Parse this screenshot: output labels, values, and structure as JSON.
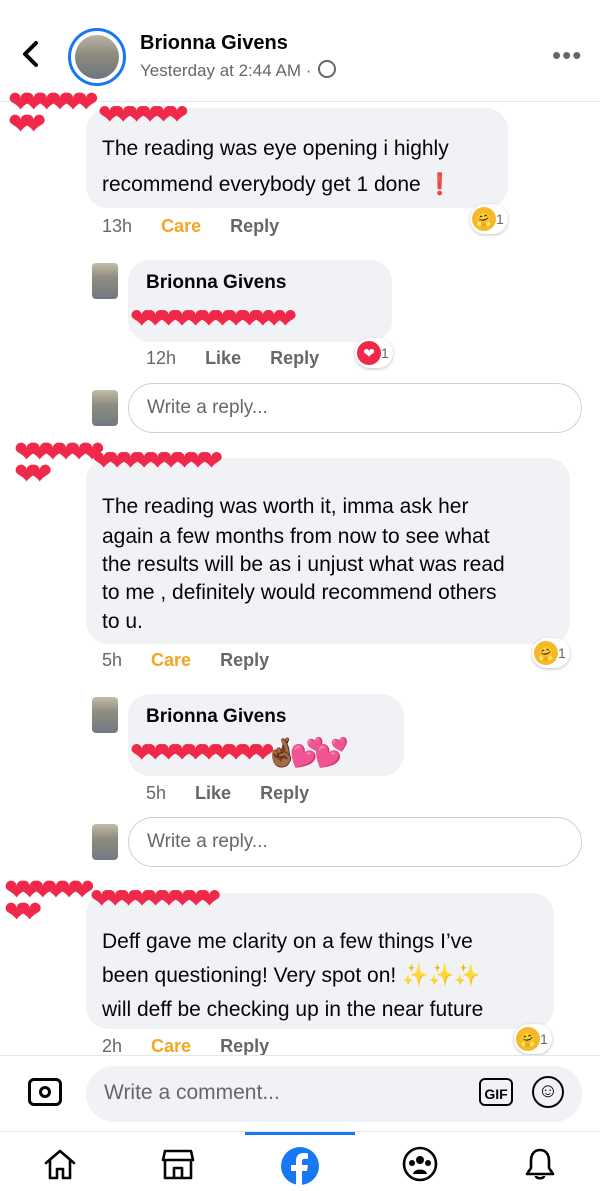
{
  "header": {
    "back_icon": "chevron-left-icon",
    "name": "Brionna Givens",
    "time": "Yesterday at 2:44 AM ·",
    "privacy_icon": "globe-icon",
    "more_icon": "more-icon"
  },
  "comments": [
    {
      "name_obscured": "❤❤❤❤❤❤",
      "avatar_obscured": "❤❤❤❤❤❤❤❤",
      "text_line1": "The reading was eye opening i highly",
      "text_line2": "recommend everybody get 1 done ❗",
      "age": "13h",
      "care": "Care",
      "reply": "Reply",
      "reaction_emoji": "🤗",
      "reaction_count": "1",
      "replies": [
        {
          "name": "Brionna Givens",
          "text": "❤❤❤❤❤❤❤❤❤❤ ❤ ❤",
          "age": "12h",
          "like": "Like",
          "reply": "Reply",
          "reaction_emoji": "❤",
          "reaction_count": "1"
        }
      ],
      "reply_placeholder": "Write a reply..."
    },
    {
      "name_obscured": "❤❤❤❤❤❤❤❤❤",
      "avatar_obscured": "❤❤❤❤❤❤❤❤",
      "text_lines": [
        "The reading was worth it, imma ask her",
        "again a few months from now to see what",
        "the results will be as i unjust what was read",
        "to me , definitely would recommend others",
        "to u."
      ],
      "age": "5h",
      "care": "Care",
      "reply": "Reply",
      "reaction_emoji": "🤗",
      "reaction_count": "1",
      "replies": [
        {
          "name": "Brionna Givens",
          "text": "❤❤❤❤❤❤❤❤❤❤🤞🏾💕💕",
          "age": "5h",
          "like": "Like",
          "reply": "Reply"
        }
      ],
      "reply_placeholder": "Write a reply..."
    },
    {
      "name_obscured": "❤❤❤❤❤❤❤❤❤",
      "avatar_obscured": "❤❤❤❤❤❤❤❤",
      "text_line1": "Deff gave me clarity on a few things I’ve",
      "text_line2": "been questioning! Very spot on! ✨✨✨",
      "text_line3": "will deff be checking up in the near future",
      "age": "2h",
      "care": "Care",
      "reply": "Reply",
      "reaction_emoji": "🤗",
      "reaction_count": "1"
    }
  ],
  "comment_bar": {
    "placeholder": "Write a comment...",
    "gif": "GIF",
    "camera_icon": "camera-icon",
    "emoji_icon": "smiley-icon"
  },
  "nav": {
    "items": [
      "home-icon",
      "marketplace-icon",
      "facebook-icon",
      "groups-icon",
      "notifications-icon"
    ],
    "active": "facebook-icon",
    "accent": "#1877f2"
  }
}
